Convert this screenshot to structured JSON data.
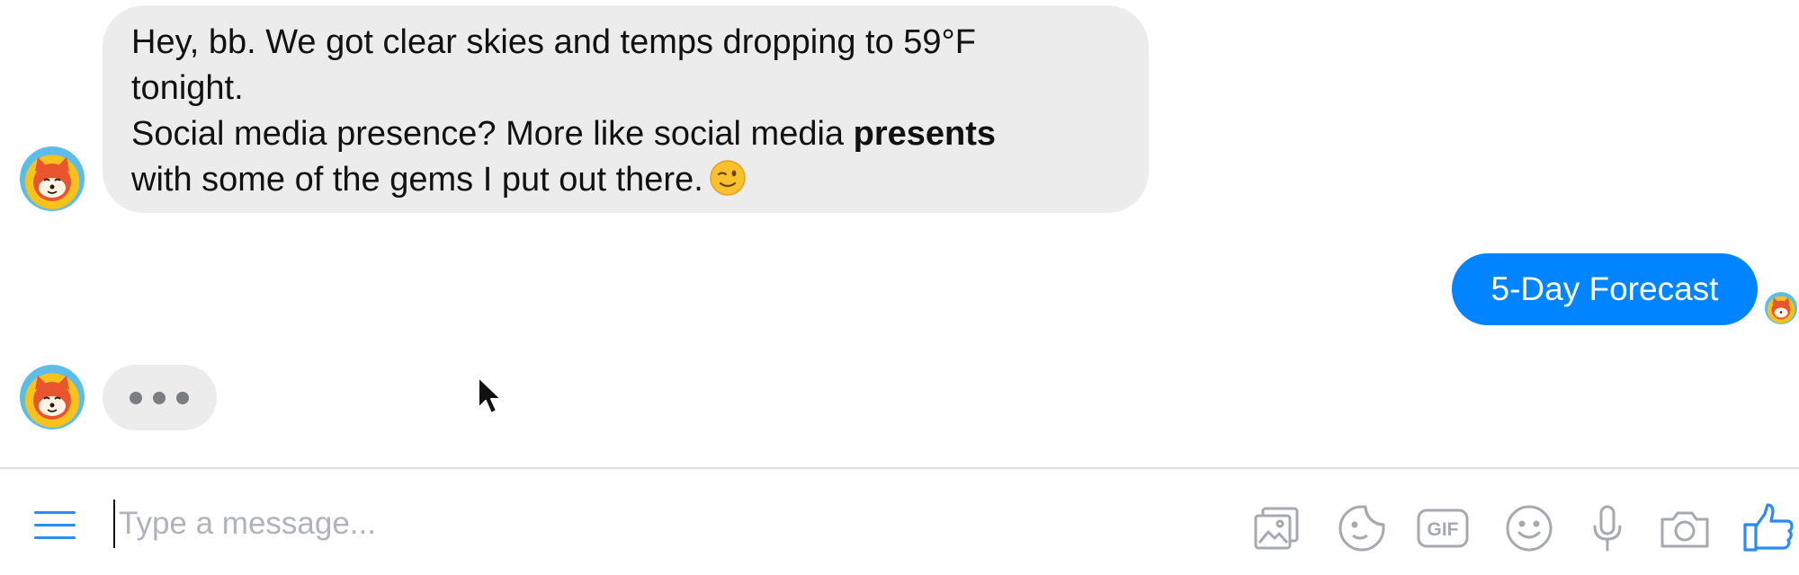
{
  "conversation": {
    "bot_message": {
      "line1": "Hey, bb. We got clear skies and temps dropping to 59°F",
      "line2": "tonight.",
      "line3_prefix": "Social media presence? More like social media ",
      "line3_bold": "presents",
      "line4": "with some of the gems I put out there.",
      "emoji": "winking-face-emoji"
    },
    "user_message": "5-Day Forecast",
    "typing_indicator": "three-dots"
  },
  "composer": {
    "placeholder": "Type a message...",
    "value": "",
    "tools": [
      "menu-icon",
      "image-icon",
      "sticker-icon",
      "gif-icon",
      "emoji-icon",
      "microphone-icon",
      "camera-icon",
      "thumbs-up-icon"
    ],
    "gif_label": "GIF"
  },
  "colors": {
    "accent": "#0084ff",
    "bubble_incoming": "#ececec",
    "icon_gray": "#a6a9ae",
    "icon_blue": "#2a8bf2"
  }
}
